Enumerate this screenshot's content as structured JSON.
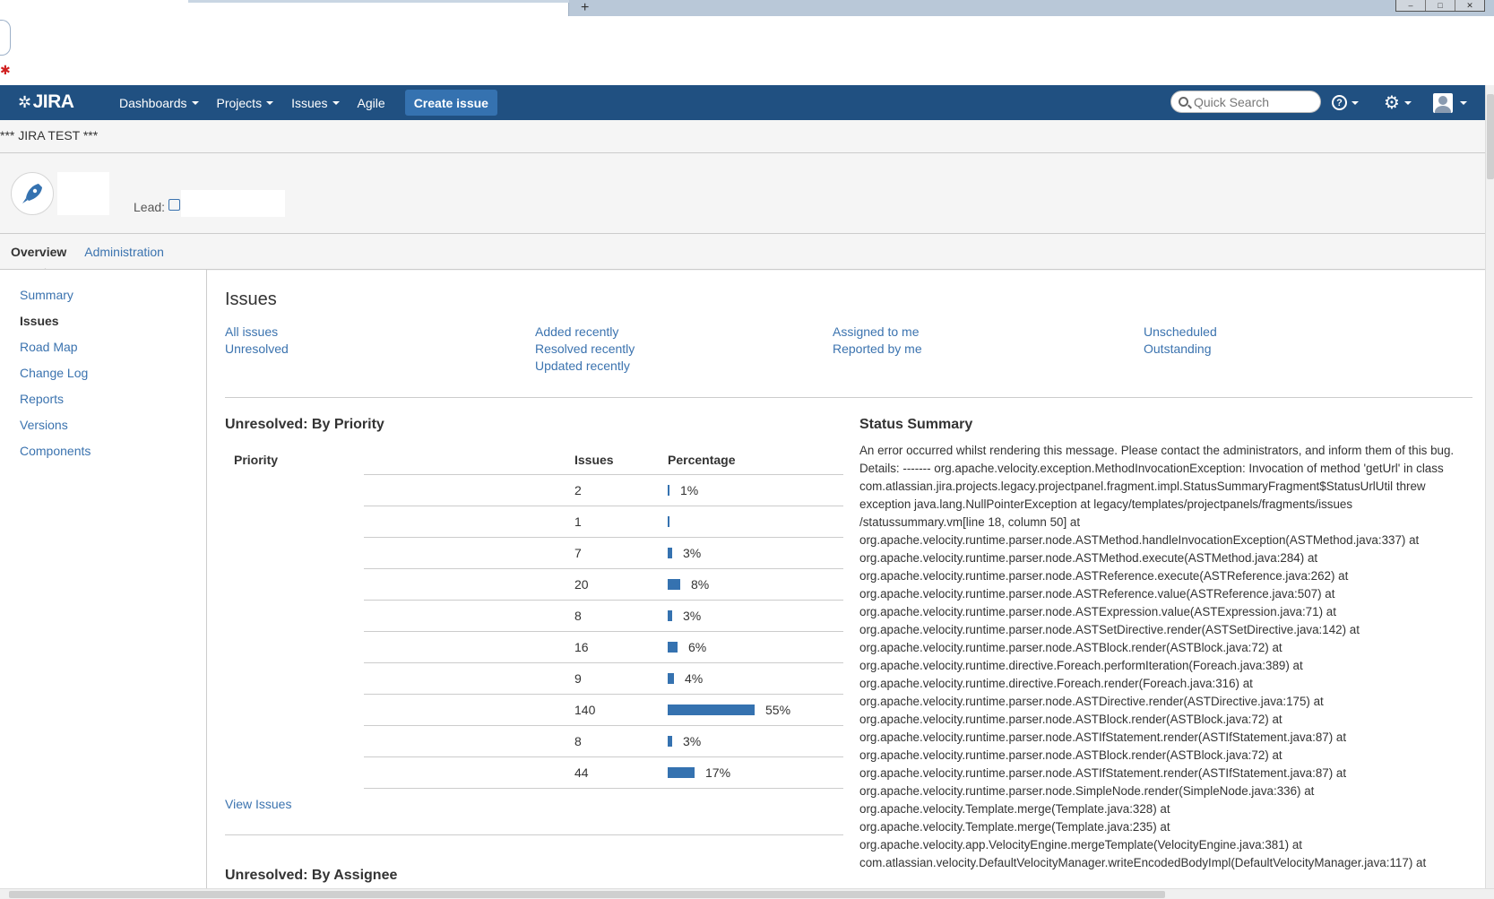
{
  "browser": {
    "new_tab_label": "+"
  },
  "header": {
    "logo": "JIRA",
    "nav": [
      {
        "label": "Dashboards",
        "has_caret": true
      },
      {
        "label": "Projects",
        "has_caret": true
      },
      {
        "label": "Issues",
        "has_caret": true
      },
      {
        "label": "Agile",
        "has_caret": false
      }
    ],
    "create_label": "Create issue",
    "search_placeholder": "Quick Search",
    "help_glyph": "?",
    "gear_glyph": "⚙",
    "brand_color": "#205081"
  },
  "banner": "*** JIRA TEST ***",
  "project": {
    "lead_label": "Lead:"
  },
  "tabs": [
    {
      "label": "Overview",
      "active": true
    },
    {
      "label": "Administration",
      "active": false
    }
  ],
  "sidebar": {
    "items": [
      {
        "label": "Summary",
        "active": false
      },
      {
        "label": "Issues",
        "active": true
      },
      {
        "label": "Road Map",
        "active": false
      },
      {
        "label": "Change Log",
        "active": false
      },
      {
        "label": "Reports",
        "active": false
      },
      {
        "label": "Versions",
        "active": false
      },
      {
        "label": "Components",
        "active": false
      }
    ]
  },
  "issues": {
    "title": "Issues",
    "filters": {
      "col1": [
        "All issues",
        "Unresolved"
      ],
      "col2": [
        "Added recently",
        "Resolved recently",
        "Updated recently"
      ],
      "col3": [
        "Assigned to me",
        "Reported by me"
      ],
      "col4": [
        "Unscheduled",
        "Outstanding"
      ]
    },
    "by_priority": {
      "title": "Unresolved: By Priority",
      "headers": {
        "priority": "Priority",
        "issues": "Issues",
        "percentage": "Percentage"
      },
      "rows": [
        {
          "issues": "2",
          "percentage": "1%",
          "fraction": 0.01
        },
        {
          "issues": "1",
          "percentage": "",
          "fraction": 0.0
        },
        {
          "issues": "7",
          "percentage": "3%",
          "fraction": 0.03
        },
        {
          "issues": "20",
          "percentage": "8%",
          "fraction": 0.08
        },
        {
          "issues": "8",
          "percentage": "3%",
          "fraction": 0.03
        },
        {
          "issues": "16",
          "percentage": "6%",
          "fraction": 0.06
        },
        {
          "issues": "9",
          "percentage": "4%",
          "fraction": 0.04
        },
        {
          "issues": "140",
          "percentage": "55%",
          "fraction": 0.55
        },
        {
          "issues": "8",
          "percentage": "3%",
          "fraction": 0.03
        },
        {
          "issues": "44",
          "percentage": "17%",
          "fraction": 0.17
        }
      ],
      "view_issues_label": "View Issues"
    },
    "by_assignee_title": "Unresolved: By Assignee",
    "status_summary": {
      "title": "Status Summary",
      "text": "An error occurred whilst rendering this message. Please contact the administrators, and inform them of this bug. Details: ------- org.apache.velocity.exception.MethodInvocationException: Invocation of method 'getUrl' in class com.atlassian.jira.projects.legacy.projectpanel.fragment.impl.StatusSummaryFragment$StatusUrlUtil threw exception java.lang.NullPointerException at legacy/templates/projectpanels/fragments/issues /statussummary.vm[line 18, column 50] at org.apache.velocity.runtime.parser.node.ASTMethod.handleInvocationException(ASTMethod.java:337) at org.apache.velocity.runtime.parser.node.ASTMethod.execute(ASTMethod.java:284) at org.apache.velocity.runtime.parser.node.ASTReference.execute(ASTReference.java:262) at org.apache.velocity.runtime.parser.node.ASTReference.value(ASTReference.java:507) at org.apache.velocity.runtime.parser.node.ASTExpression.value(ASTExpression.java:71) at org.apache.velocity.runtime.parser.node.ASTSetDirective.render(ASTSetDirective.java:142) at org.apache.velocity.runtime.parser.node.ASTBlock.render(ASTBlock.java:72) at org.apache.velocity.runtime.directive.Foreach.performIteration(Foreach.java:389) at org.apache.velocity.runtime.directive.Foreach.render(Foreach.java:316) at org.apache.velocity.runtime.parser.node.ASTDirective.render(ASTDirective.java:175) at org.apache.velocity.runtime.parser.node.ASTBlock.render(ASTBlock.java:72) at org.apache.velocity.runtime.parser.node.ASTIfStatement.render(ASTIfStatement.java:87) at org.apache.velocity.runtime.parser.node.ASTBlock.render(ASTBlock.java:72) at org.apache.velocity.runtime.parser.node.ASTIfStatement.render(ASTIfStatement.java:87) at org.apache.velocity.runtime.parser.node.SimpleNode.render(SimpleNode.java:336) at org.apache.velocity.Template.merge(Template.java:328) at org.apache.velocity.Template.merge(Template.java:235) at org.apache.velocity.app.VelocityEngine.mergeTemplate(VelocityEngine.java:381) at com.atlassian.velocity.DefaultVelocityManager.writeEncodedBodyImpl(DefaultVelocityManager.java:117) at"
    }
  }
}
